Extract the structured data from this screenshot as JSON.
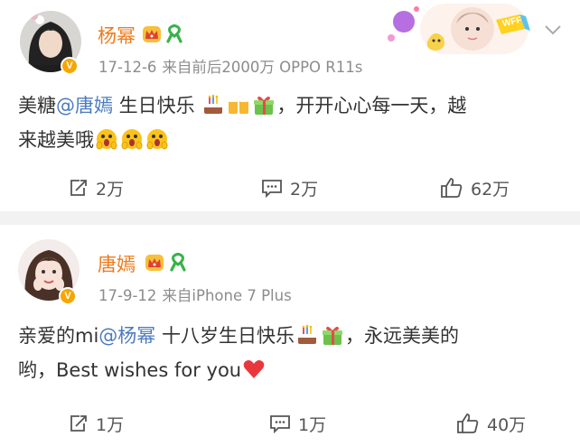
{
  "posts": [
    {
      "author": "杨幂",
      "time": "17-12-6",
      "source_prefix": "来自",
      "source": "前后2000万 OPPO R11s",
      "text": {
        "before": "美糖",
        "mention": "@唐嫣",
        "middle": " 生日快乐",
        "after": "，开开心心每一天，越",
        "line2": "来越美哦"
      },
      "banner_text": "WFF",
      "reposts": "2万",
      "comments": "2万",
      "likes": "62万"
    },
    {
      "author": "唐嫣",
      "time": "17-9-12",
      "source_prefix": "来自",
      "source": "iPhone 7 Plus",
      "text": {
        "before": "亲爱的mi",
        "mention": "@杨幂",
        "middle": " 十八岁生日快乐",
        "after": "，永远美美的",
        "line2": "哟，Best wishes for you"
      },
      "reposts": "1万",
      "comments": "1万",
      "likes": "40万"
    }
  ],
  "icons": {
    "repost": "repost-icon",
    "comment": "comment-icon",
    "like": "thumbs-up-icon",
    "crown": "crown-badge-icon",
    "ribbon": "green-ribbon-icon",
    "cake": "birthday-cake-emoji",
    "beer": "beer-cheers-emoji",
    "gift": "gift-emoji",
    "shocked": "shocked-face-emoji",
    "heart": "red-heart-emoji",
    "chevron": "chevron-down-icon"
  },
  "colors": {
    "name": "#ef7a1a",
    "mention": "#4b7bc0",
    "meta": "#8c8c8c",
    "verified": "#f7a600"
  }
}
